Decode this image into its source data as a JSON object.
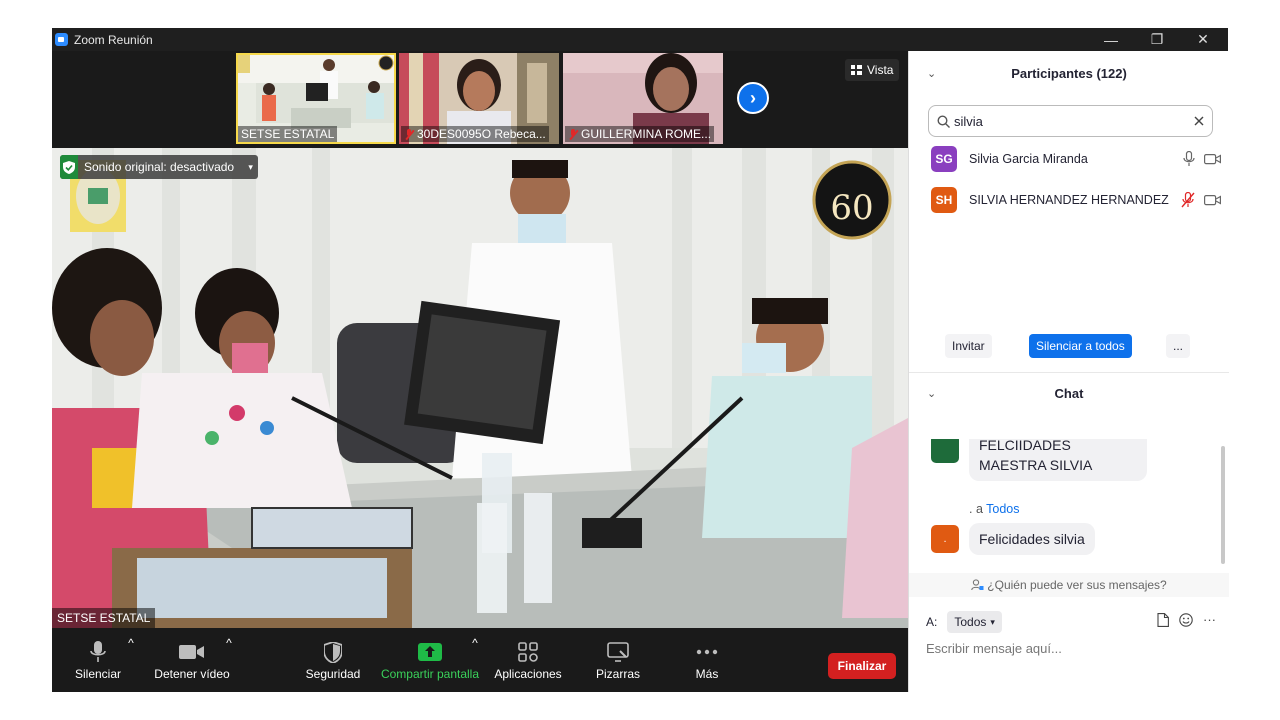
{
  "window": {
    "title": "Zoom Reunión",
    "minimize": "—",
    "restore": "❐",
    "close": "✕"
  },
  "thumbnails": [
    {
      "label": "SETSE ESTATAL",
      "muted": false,
      "active": true
    },
    {
      "label": "30DES0095O  Rebeca...",
      "muted": true,
      "active": false
    },
    {
      "label": "GUILLERMINA ROME...",
      "muted": true,
      "active": false
    }
  ],
  "view_button": {
    "label": "Vista"
  },
  "main_video": {
    "original_sound": "Sonido original: desactivado",
    "speaker_label": "SETSE ESTATAL",
    "badge": "60"
  },
  "toolbar": {
    "mute": "Silenciar",
    "stop_video": "Detener vídeo",
    "security": "Seguridad",
    "share_screen": "Compartir pantalla",
    "apps": "Aplicaciones",
    "whiteboards": "Pizarras",
    "more": "Más",
    "end": "Finalizar"
  },
  "participants": {
    "header": "Participantes (122)",
    "search_value": "silvia",
    "list": [
      {
        "initials": "SG",
        "name": "Silvia Garcia Miranda",
        "color": "#8a3fbf",
        "muted": false
      },
      {
        "initials": "SH",
        "name": "SILVIA HERNANDEZ HERNANDEZ",
        "color": "#e05a12",
        "muted": true
      }
    ],
    "invite": "Invitar",
    "mute_all": "Silenciar a todos",
    "more": "..."
  },
  "chat": {
    "header": "Chat",
    "messages": [
      {
        "text": "FELCIIDADES MAESTRA SILVIA"
      },
      {
        "meta_prefix": ". a ",
        "meta_to": "Todos",
        "text": "Felicidades silvia"
      }
    ],
    "who_can_see": "¿Quién puede ver sus mensajes?",
    "to_label": "A:",
    "to_value": "Todos",
    "placeholder": "Escribir mensaje aquí..."
  },
  "colors": {
    "accent": "#0e71eb",
    "end": "#d32020",
    "share": "#1fbb47",
    "dark": "#1a1a1a"
  }
}
